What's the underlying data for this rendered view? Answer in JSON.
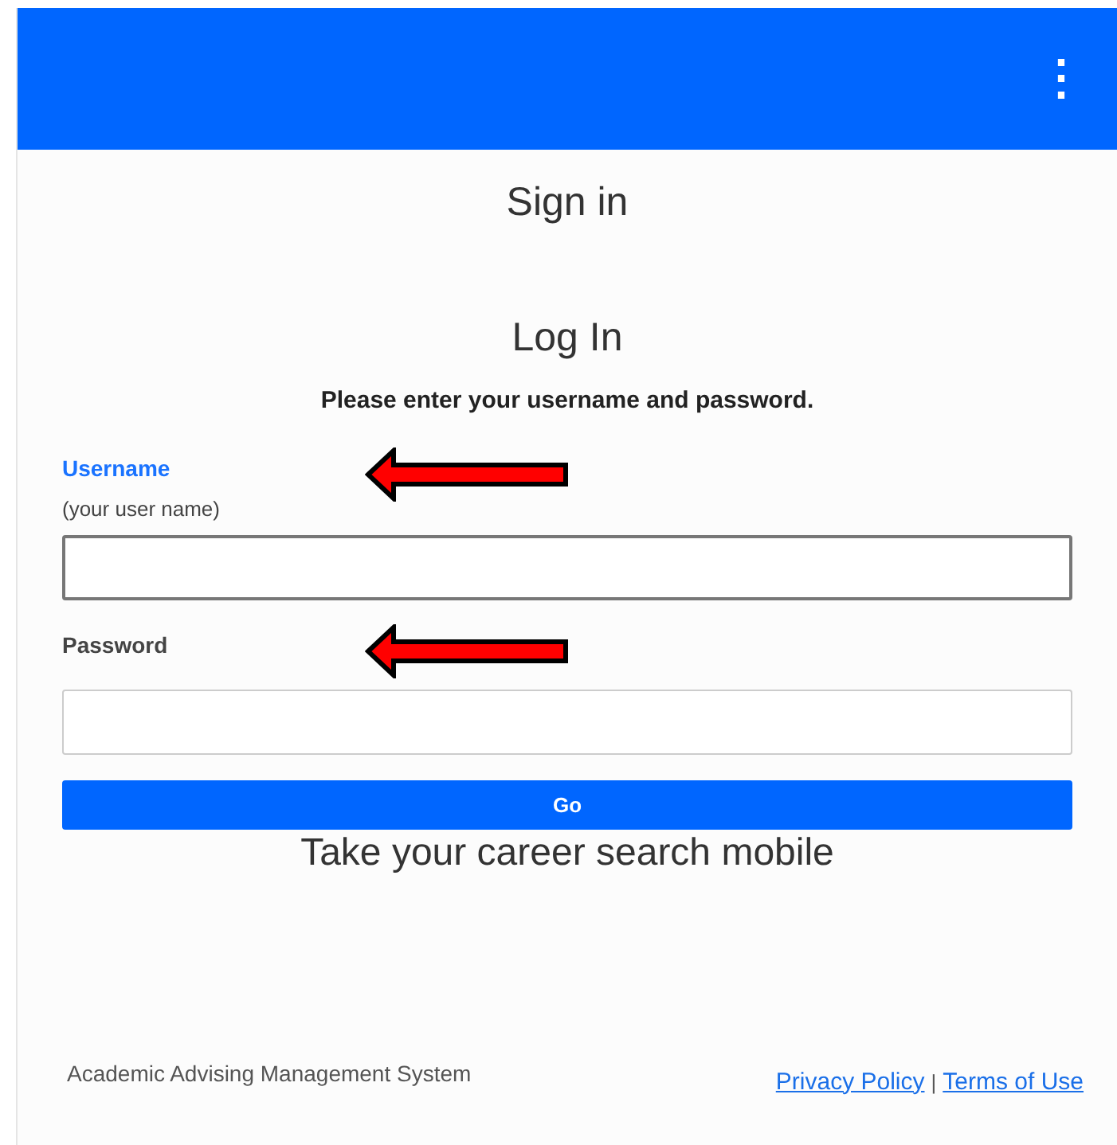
{
  "header": {
    "menu_icon": "⋮"
  },
  "title": "Sign in",
  "form": {
    "heading": "Log In",
    "instructions": "Please enter your username and password.",
    "fields": [
      {
        "label": "Username",
        "hint": "(your user name)",
        "focused": true,
        "arrow": true
      },
      {
        "label": "Password",
        "focused": false,
        "arrow": true
      }
    ],
    "submit": "Go"
  },
  "tagline": "Take your career search mobile",
  "footer": {
    "system_name": "Academic Advising Management System",
    "links": [
      "Privacy Policy",
      "Terms of Use"
    ],
    "separator": "|"
  }
}
